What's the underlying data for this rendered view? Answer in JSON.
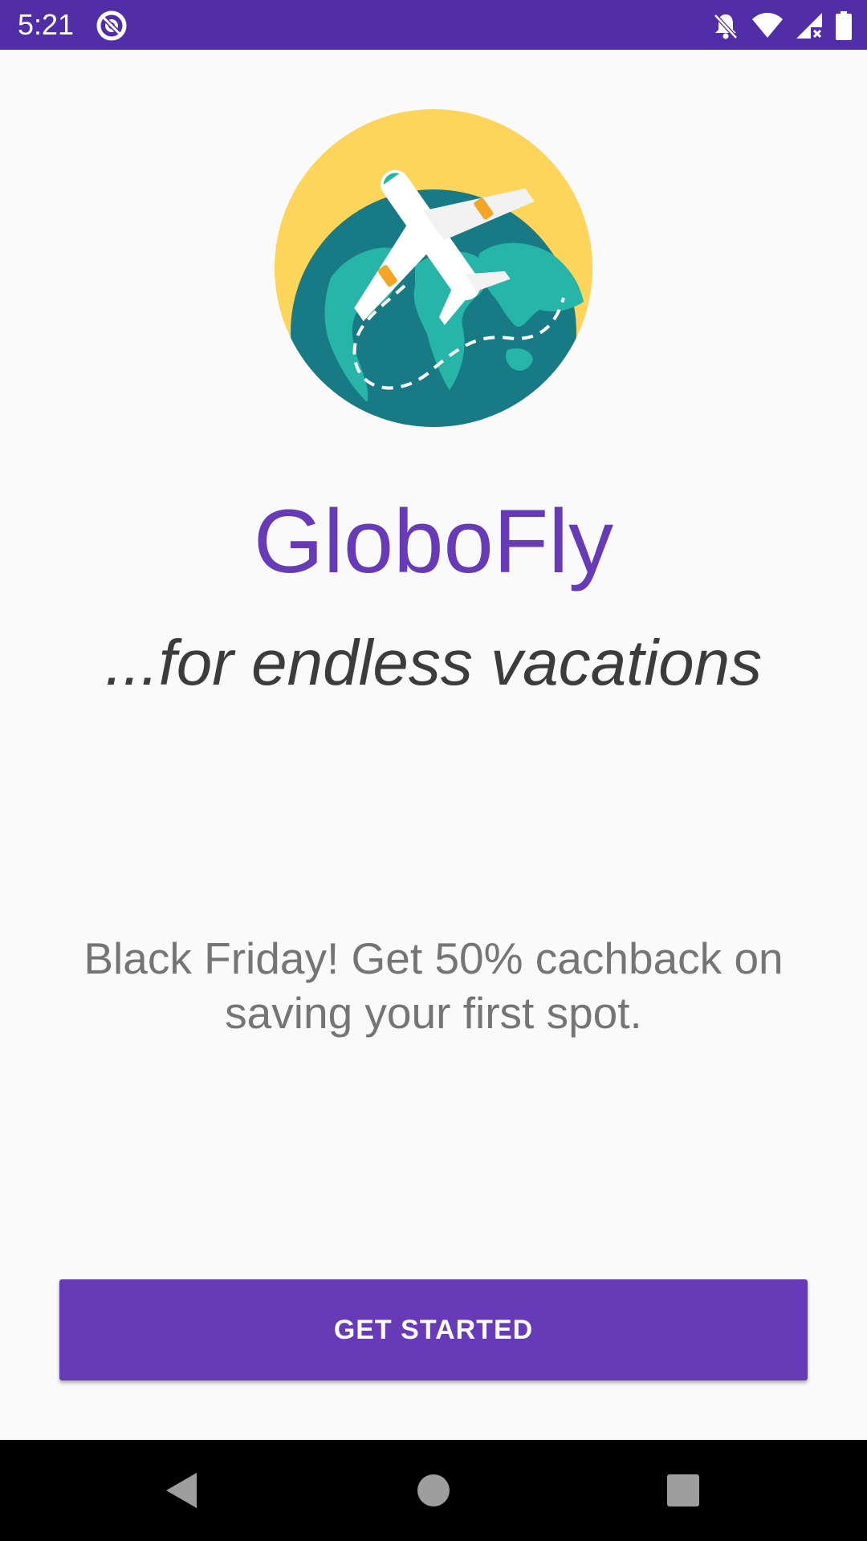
{
  "status_bar": {
    "time": "5:21",
    "left_icon": "data-saver-icon",
    "right_icons": [
      "notifications-off-icon",
      "wifi-icon",
      "cell-signal-icon",
      "battery-icon"
    ],
    "background": "#512da8"
  },
  "logo": {
    "icon": "globe-airplane-logo"
  },
  "main": {
    "app_title": "GloboFly",
    "tagline": "...for endless vacations",
    "promo": "Black Friday! Get 50% cachback on saving your first spot.",
    "cta_label": "GET STARTED"
  },
  "colors": {
    "accent": "#673ab7",
    "status_bar": "#512da8",
    "tagline_text": "#3c3c3c",
    "promo_text": "#757575",
    "background": "#fafafa",
    "logo_sun": "#fdd55a",
    "logo_ocean": "#187a85",
    "logo_land": "#26b5a8"
  },
  "nav_bar": {
    "buttons": [
      "back-icon",
      "home-icon",
      "recents-icon"
    ]
  }
}
